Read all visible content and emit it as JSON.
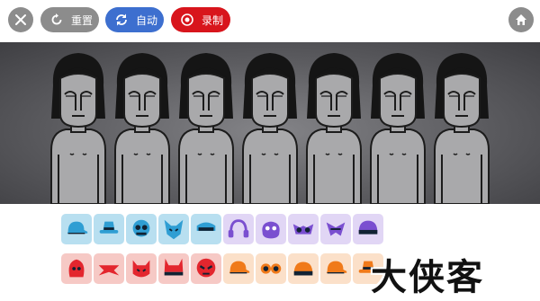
{
  "toolbar": {
    "reset_label": "重置",
    "auto_label": "自动",
    "record_label": "录制",
    "colors": {
      "gray": "#8c8c8c",
      "blue": "#3d6fcf",
      "red": "#d8151c"
    }
  },
  "stage": {
    "performer_count": 7,
    "background": "#5c5c60"
  },
  "sound_tray": {
    "row1": [
      {
        "kind": "cap",
        "color": "#2f9ed3"
      },
      {
        "kind": "hat",
        "color": "#2f9ed3"
      },
      {
        "kind": "mask",
        "color": "#2f9ed3"
      },
      {
        "kind": "fox",
        "color": "#2f9ed3"
      },
      {
        "kind": "visor",
        "color": "#2f9ed3"
      },
      {
        "kind": "headphones",
        "color": "#7a4fd0"
      },
      {
        "kind": "blob",
        "color": "#7a4fd0"
      },
      {
        "kind": "glasses",
        "color": "#7a4fd0"
      },
      {
        "kind": "wing",
        "color": "#7a4fd0"
      },
      {
        "kind": "helmet",
        "color": "#7a4fd0"
      }
    ],
    "row2": [
      {
        "kind": "hood",
        "color": "#e3262e"
      },
      {
        "kind": "bandana",
        "color": "#e3262e"
      },
      {
        "kind": "devil",
        "color": "#e3262e"
      },
      {
        "kind": "horns",
        "color": "#e3262e"
      },
      {
        "kind": "skull",
        "color": "#e3262e"
      },
      {
        "kind": "cap",
        "color": "#f07a1a"
      },
      {
        "kind": "goggles",
        "color": "#f07a1a"
      },
      {
        "kind": "beanie",
        "color": "#f07a1a"
      },
      {
        "kind": "cap",
        "color": "#f07a1a"
      },
      {
        "kind": "hat",
        "color": "#f07a1a"
      }
    ]
  },
  "watermark": {
    "text": "大侠客"
  }
}
